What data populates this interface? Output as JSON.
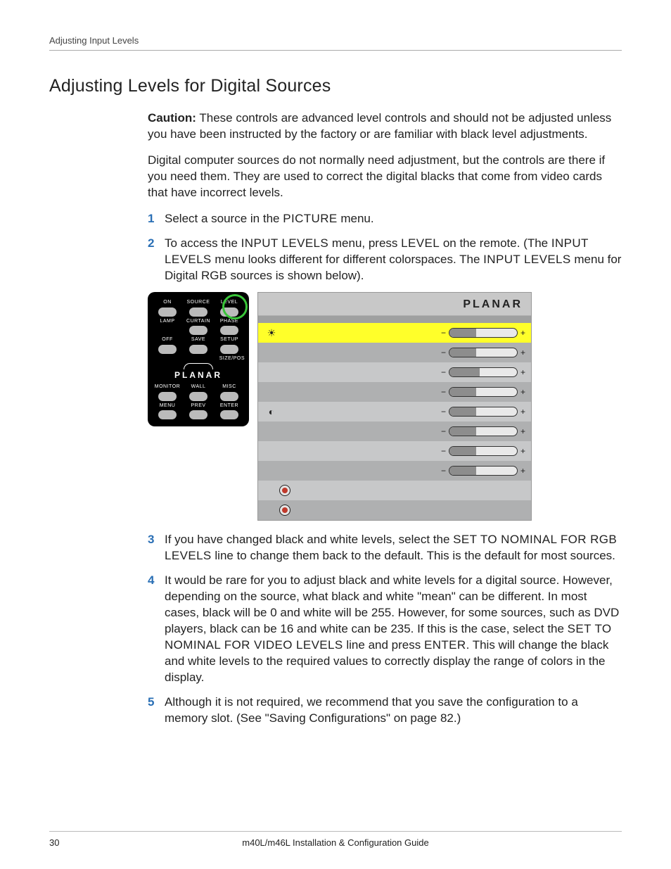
{
  "header": {
    "running": "Adjusting Input Levels"
  },
  "section_title": "Adjusting Levels for Digital Sources",
  "caution_label": "Caution:",
  "caution_text": " These controls are advanced level controls and should not be adjusted unless you have been instructed by the factory or are familiar with black level adjustments.",
  "intro": "Digital computer sources do not normally need adjustment, but the controls are there if you need them. They are used to correct the digital blacks that come from video cards that have incorrect levels.",
  "steps": {
    "s1a": "Select a source in the ",
    "s1b": "PICTURE",
    "s1c": " menu.",
    "s2a": "To access the ",
    "s2b": "INPUT LEVELS",
    "s2c": " menu, press ",
    "s2d": "LEVEL",
    "s2e": " on the remote. (The ",
    "s2f": "INPUT LEVELS",
    "s2g": " menu looks different for different colorspaces. The ",
    "s2h": "INPUT LEVELS",
    "s2i": " menu for Digital RGB sources is shown below).",
    "s3a": "If you have changed black and white levels, select the ",
    "s3b": "SET TO NOMINAL FOR RGB LEVELS",
    "s3c": " line to change them back to the default. This is the default for most sources.",
    "s4a": "It would be rare for you to adjust black and white levels for a digital source. However, depending on the source, what black and white \"mean\" can be different. In most cases, black will be 0 and white will be 255. However, for some sources, such as DVD players, black can be 16 and white can be 235. If this is the case, select the ",
    "s4b": "SET TO NOMINAL FOR VIDEO LEVELS",
    "s4c": " line and press ",
    "s4d": "ENTER",
    "s4e": ". This will change the black and white levels to the required values to correctly display the range of colors in the display.",
    "s5": "Although it is not required, we recommend that you save the configuration to a memory slot. (See \"Saving Configurations\" on page 82.)"
  },
  "nums": {
    "n1": "1",
    "n2": "2",
    "n3": "3",
    "n4": "4",
    "n5": "5"
  },
  "remote": {
    "on": "ON",
    "source": "SOURCE",
    "level": "LEVEL",
    "lamp": "LAMP",
    "curtain": "CURTAIN",
    "phase": "PHASE",
    "off": "OFF",
    "save": "SAVE",
    "setup": "SETUP",
    "sizepos": "SIZE/POS",
    "brand": "PLANAR",
    "monitor": "MONITOR",
    "wall": "WALL",
    "misc": "MISC",
    "menu": "MENU",
    "prev": "PREV",
    "enter": "ENTER"
  },
  "osd": {
    "brand": "PLANAR",
    "sliders": [
      {
        "fill": 40
      },
      {
        "fill": 40
      },
      {
        "fill": 45
      },
      {
        "fill": 40
      },
      {
        "fill": 40
      },
      {
        "fill": 40
      },
      {
        "fill": 40
      },
      {
        "fill": 40
      }
    ]
  },
  "footer": {
    "page": "30",
    "title": "m40L/m46L Installation & Configuration Guide"
  }
}
